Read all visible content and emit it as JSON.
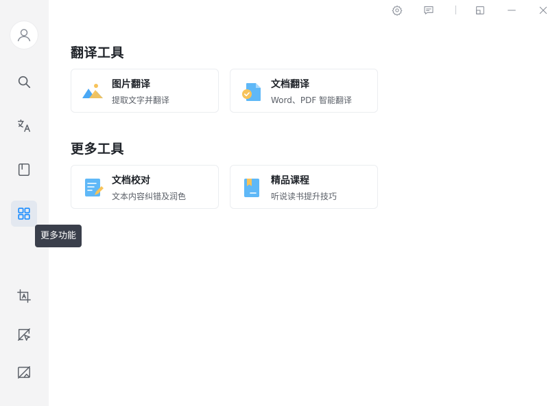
{
  "sidebar": {
    "items": [
      {
        "icon": "user-avatar-icon"
      },
      {
        "icon": "search-icon"
      },
      {
        "icon": "translate-icon"
      },
      {
        "icon": "bookmark-icon"
      },
      {
        "icon": "grid-apps-icon",
        "active": true
      },
      {
        "icon": "crop-text-icon"
      },
      {
        "icon": "screen-select-icon"
      },
      {
        "icon": "image-translate-icon"
      }
    ],
    "tooltip": "更多功能"
  },
  "titlebar": {
    "icons": [
      "settings-icon",
      "feedback-icon",
      "restore-window-icon",
      "minimize-icon",
      "close-icon"
    ]
  },
  "sections": [
    {
      "title": "翻译工具",
      "cards": [
        {
          "title": "图片翻译",
          "desc": "提取文字并翻译",
          "icon": "image-translate-card-icon"
        },
        {
          "title": "文档翻译",
          "desc": "Word、PDF 智能翻译",
          "icon": "document-translate-card-icon"
        }
      ]
    },
    {
      "title": "更多工具",
      "cards": [
        {
          "title": "文档校对",
          "desc": "文本内容纠错及润色",
          "icon": "proofread-card-icon"
        },
        {
          "title": "精品课程",
          "desc": "听说读书提升技巧",
          "icon": "course-card-icon"
        }
      ]
    }
  ],
  "colors": {
    "sidebar_bg": "#f4f4f5",
    "accent": "#1a8cff",
    "tooltip_bg": "#3a3f4b"
  }
}
